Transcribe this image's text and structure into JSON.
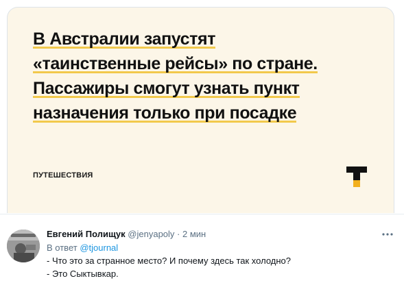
{
  "card": {
    "headline_lines": [
      "В Австралии запустят",
      "«таинственные рейсы» по стране.",
      "Пассажиры смогут узнать пункт",
      "назначения только при посадке"
    ],
    "category": "ПУТЕШЕСТВИЯ",
    "logo_icon": "tjournal-logo-icon",
    "background_color": "#fcf6e8",
    "underline_color": "#f2c94c"
  },
  "tweet": {
    "author_name": "Евгений Полищук",
    "handle": "@jenyapoly",
    "separator": "·",
    "time": "2 мин",
    "reply_prefix": "В ответ",
    "reply_to": "@tjournal",
    "lines": [
      "- Что это за странное место? И почему здесь так холодно?",
      "- Это Сыктывкар."
    ],
    "more_icon": "more-horizontal-icon",
    "link_color": "#1b95e0",
    "muted_color": "#5b7083"
  }
}
